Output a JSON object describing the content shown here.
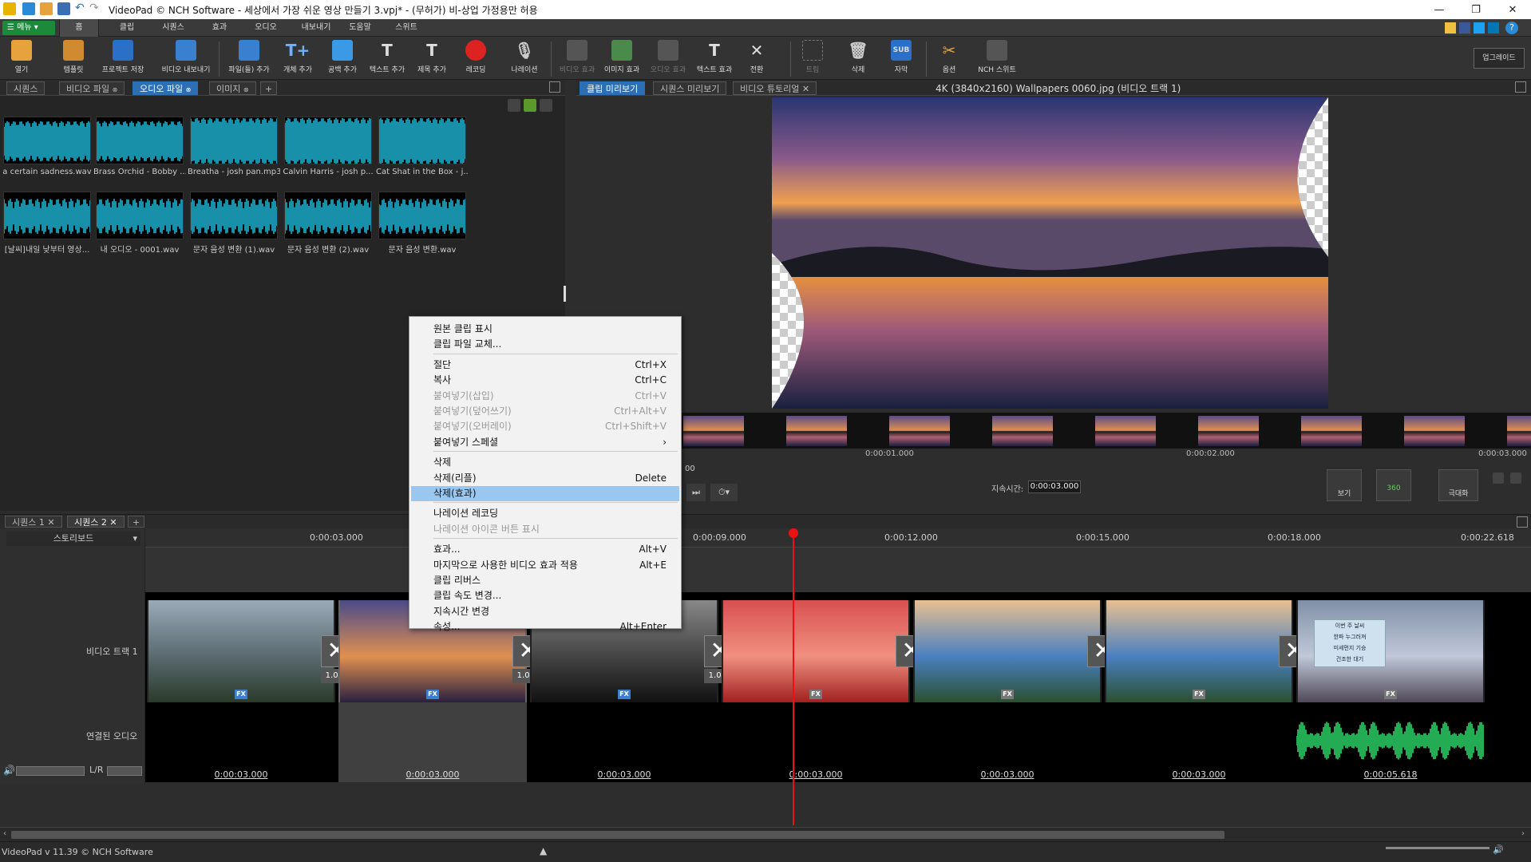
{
  "titlebar": {
    "title": "VideoPad © NCH Software - 세상에서 가장 쉬운 영상 만들기 3.vpj* - (무허가) 비-상업 가정용만 허용",
    "minimize": "—",
    "maximize": "❐",
    "close": "✕"
  },
  "menubar": {
    "menu_button": "☰ 메뉴 ▾",
    "tabs": [
      "홈",
      "클립",
      "시퀀스",
      "효과",
      "오디오",
      "내보내기",
      "도움말",
      "스위트"
    ]
  },
  "toolbar": {
    "buttons": [
      "열기",
      "템플릿",
      "프로젝트 저장",
      "비디오 내보내기",
      "파일(들) 추가",
      "개체 추가",
      "공백 추가",
      "텍스트 추가",
      "제목 추가",
      "레코딩",
      "나레이션",
      "비디오 효과",
      "이미지 효과",
      "오디오 효과",
      "텍스트 효과",
      "전환",
      "트림",
      "삭제",
      "자막",
      "옵션",
      "NCH 스위트"
    ],
    "upgrade": "업그레이드"
  },
  "media": {
    "tabs": [
      "시퀀스",
      "비디오 파일",
      "오디오 파일",
      "이미지"
    ],
    "counts": [
      "",
      "⊗",
      "⊗",
      "⊗"
    ],
    "add_tab": "+",
    "files": [
      "a certain sadness.wav",
      "Brass Orchid - Bobby ...",
      "Breatha - josh pan.mp3",
      "Calvin Harris - josh p...",
      "Cat Shat in the Box - j...",
      "[날씨]내일 낮부터 영상...",
      "내 오디오 - 0001.wav",
      "문자 음성 변환 (1).wav",
      "문자 음성 변환 (2).wav",
      "문자 음성 변환.wav"
    ]
  },
  "preview": {
    "tabs": [
      "클립 미리보기",
      "시퀀스 미리보기",
      "비디오 튜토리얼"
    ],
    "clip_title": "4K (3840x2160) Wallpapers 0060.jpg (비디오 트랙 1)",
    "ruler": [
      "0:00:01.000",
      "0:00:02.000",
      "0:00:03.000"
    ],
    "duration_label": "지속시간:",
    "duration": "0:00:03.000",
    "tc_frag": "00",
    "btn_view": "보기",
    "btn_360": "360",
    "btn_maximize": "극대화"
  },
  "timeline": {
    "seq_tabs": [
      "시퀀스 1",
      "시퀀스 2"
    ],
    "storyboard": "스토리보드",
    "ruler": [
      "0:00:03.000",
      "0:00:09.000",
      "0:00:12.000",
      "0:00:15.000",
      "0:00:18.000",
      "0:00:22.618"
    ],
    "video_track": "비디오 트랙 1",
    "audio_track": "연결된 오디오",
    "lr": "L/R",
    "transition_dur": "1.000",
    "clip_durs": [
      "0:00:03.000",
      "0:00:03.000",
      "0:00:03.000",
      "0:00:03.000",
      "0:00:03.000",
      "0:00:03.000",
      "0:00:05.618"
    ],
    "fx": "FX",
    "news_lines": [
      "이번 주 날씨",
      "한파 누그러져",
      "미세먼지 기승",
      "건조한 대기"
    ]
  },
  "context_menu": {
    "items": [
      {
        "label": "원본 클립 표시",
        "shortcut": ""
      },
      {
        "label": "클립 파일 교체...",
        "shortcut": ""
      },
      {
        "label": "절단",
        "shortcut": "Ctrl+X"
      },
      {
        "label": "복사",
        "shortcut": "Ctrl+C"
      },
      {
        "label": "붙여넣기(삽입)",
        "shortcut": "Ctrl+V"
      },
      {
        "label": "붙여넣기(덮어쓰기)",
        "shortcut": "Ctrl+Alt+V"
      },
      {
        "label": "붙여넣기(오버레이)",
        "shortcut": "Ctrl+Shift+V"
      },
      {
        "label": "붙여넣기 스페셜",
        "shortcut": "›"
      },
      {
        "label": "삭제",
        "shortcut": ""
      },
      {
        "label": "삭제(리플)",
        "shortcut": "Delete"
      },
      {
        "label": "삭제(효과)",
        "shortcut": ""
      },
      {
        "label": "나레이션 레코딩",
        "shortcut": ""
      },
      {
        "label": "나레이션 아이콘 버튼 표시",
        "shortcut": ""
      },
      {
        "label": "효과...",
        "shortcut": "Alt+V"
      },
      {
        "label": "마지막으로 사용한 비디오 효과 적용",
        "shortcut": "Alt+E"
      },
      {
        "label": "클립 리버스",
        "shortcut": ""
      },
      {
        "label": "클립 속도 변경...",
        "shortcut": ""
      },
      {
        "label": "지속시간 변경",
        "shortcut": ""
      },
      {
        "label": "속성...",
        "shortcut": "Alt+Enter"
      }
    ]
  },
  "status": {
    "version": "VideoPad v 11.39 © NCH Software"
  }
}
